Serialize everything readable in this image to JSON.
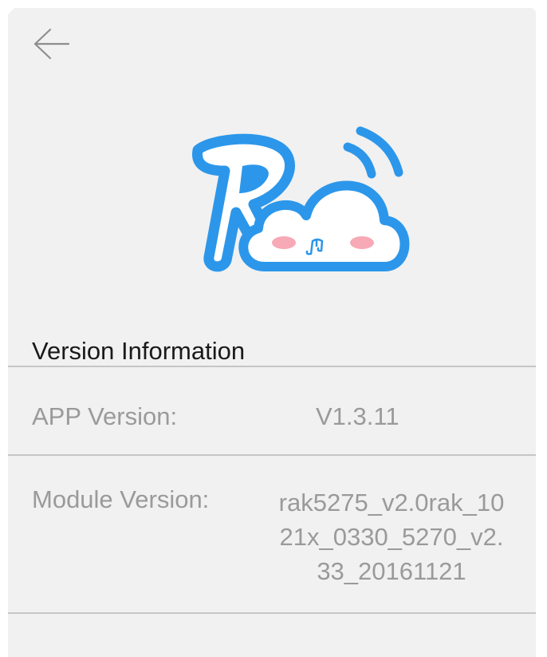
{
  "header": {
    "back_icon": "arrow-left-icon"
  },
  "logo": {
    "name": "rak-cloud-logo",
    "letter": "R",
    "colors": {
      "primary": "#2c97ea",
      "cloud": "#ffffff",
      "cheek": "#f7a9b5"
    }
  },
  "version_info": {
    "title": "Version Information",
    "app_label": "APP Version:",
    "app_value": "V1.3.11",
    "module_label": "Module Version:",
    "module_value": "rak5275_v2.0rak_1021x_0330_5270_v2.33_20161121",
    "module_value_lines": [
      "rak5275_v2.0rak_10",
      "21x_0330_5270_v2.",
      "33_20161121"
    ]
  }
}
